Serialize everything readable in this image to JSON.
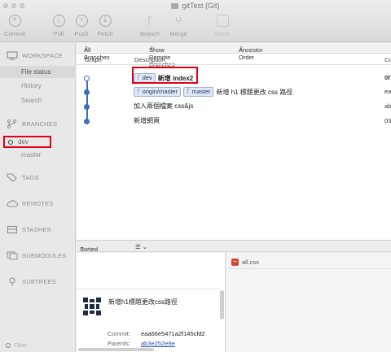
{
  "window": {
    "title": "gitTest (Git)"
  },
  "toolbar": [
    {
      "label": "Commit",
      "icon": "plus-circle-icon"
    },
    {
      "label": "Pull",
      "icon": "arrow-down-circle-icon"
    },
    {
      "label": "Push",
      "icon": "arrow-up-circle-icon"
    },
    {
      "label": "Fetch",
      "icon": "fetch-circle-icon"
    },
    {
      "label": "Branch",
      "icon": "branch-icon"
    },
    {
      "label": "Merge",
      "icon": "merge-icon"
    },
    {
      "label": "Stash",
      "icon": "stash-icon"
    }
  ],
  "sidebar": {
    "workspace": {
      "title": "WORKSPACE",
      "items": [
        "File status",
        "History",
        "Search"
      ]
    },
    "branches": {
      "title": "BRANCHES",
      "items": [
        "dev",
        "master"
      ]
    },
    "tags": "TAGS",
    "remotes": "REMOTES",
    "stashes": "STASHES",
    "submodules": "SUBMODULES",
    "subtrees": "SUBTREES",
    "filter_placeholder": "Filter"
  },
  "filterbar": {
    "branches": "All Branches",
    "remote": "Show Remote Branches",
    "order": "Ancestor Order"
  },
  "columns": {
    "graph": "Graph",
    "description": "Description",
    "commit": "Co"
  },
  "commits": [
    {
      "tags": [
        "dev"
      ],
      "message": "新增 index2",
      "hash": "0f",
      "bold": true
    },
    {
      "tags": [
        "origin/master",
        "master"
      ],
      "message": "新增 h1 標題更改 css 路徑",
      "hash": "ea",
      "bold": false
    },
    {
      "tags": [],
      "message": "加入兩個檔案 css&js",
      "hash": "ab",
      "bold": false
    },
    {
      "tags": [],
      "message": "新增網頁",
      "hash": "03",
      "bold": false
    }
  ],
  "lower": {
    "sort_label": "Sorted by path",
    "list_icon": "list-icon",
    "file": "all.css"
  },
  "commit_detail": {
    "message": "新增h1標題更改css路徑",
    "commit_label": "Commit:",
    "commit_value": "eaa66e5471a2f145cfd2",
    "parents_label": "Parents:",
    "parents_value": "ab3e252e9e"
  },
  "colors": {
    "graph": "#3b6fb6",
    "highlight": "#e0001a",
    "tag_bg": "#dfe6f4"
  }
}
